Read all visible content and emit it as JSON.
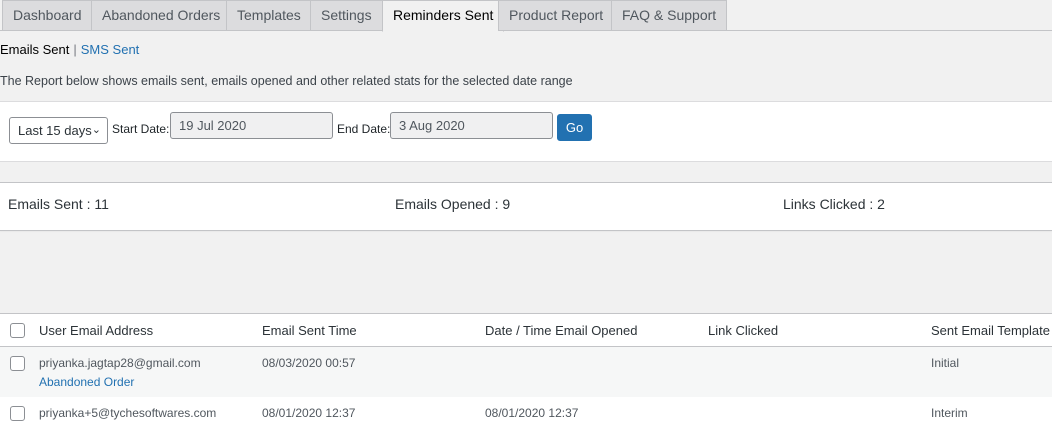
{
  "tabs": [
    {
      "label": "Dashboard"
    },
    {
      "label": "Abandoned Orders"
    },
    {
      "label": "Templates"
    },
    {
      "label": "Settings"
    },
    {
      "label": "Reminders Sent"
    },
    {
      "label": "Product Report"
    },
    {
      "label": "FAQ & Support"
    }
  ],
  "active_tab": "Reminders Sent",
  "subnav": {
    "current": "Emails Sent",
    "separator": "|",
    "other": "SMS Sent"
  },
  "description": "The Report below shows emails sent, emails opened and other related stats for the selected date range",
  "filter": {
    "range_value": "Last 15 days",
    "start_label": "Start Date:",
    "start_value": "19 Jul 2020",
    "end_label": "End Date:",
    "end_value": "3 Aug 2020",
    "go_label": "Go"
  },
  "stats": {
    "sent": "Emails Sent : 11",
    "opened": "Emails Opened : 9",
    "clicked": "Links Clicked : 2"
  },
  "table": {
    "headers": [
      "User Email Address",
      "Email Sent Time",
      "Date / Time Email Opened",
      "Link Clicked",
      "Sent Email Template"
    ],
    "rows": [
      {
        "email": "priyanka.jagtap28@gmail.com",
        "link": "Abandoned Order",
        "sent": "08/03/2020 00:57",
        "opened": "",
        "clicked": "",
        "template": "Initial"
      },
      {
        "email": "priyanka+5@tychesoftwares.com",
        "link": "",
        "sent": "08/01/2020 12:37",
        "opened": "08/01/2020 12:37",
        "clicked": "",
        "template": "Interim"
      }
    ]
  }
}
